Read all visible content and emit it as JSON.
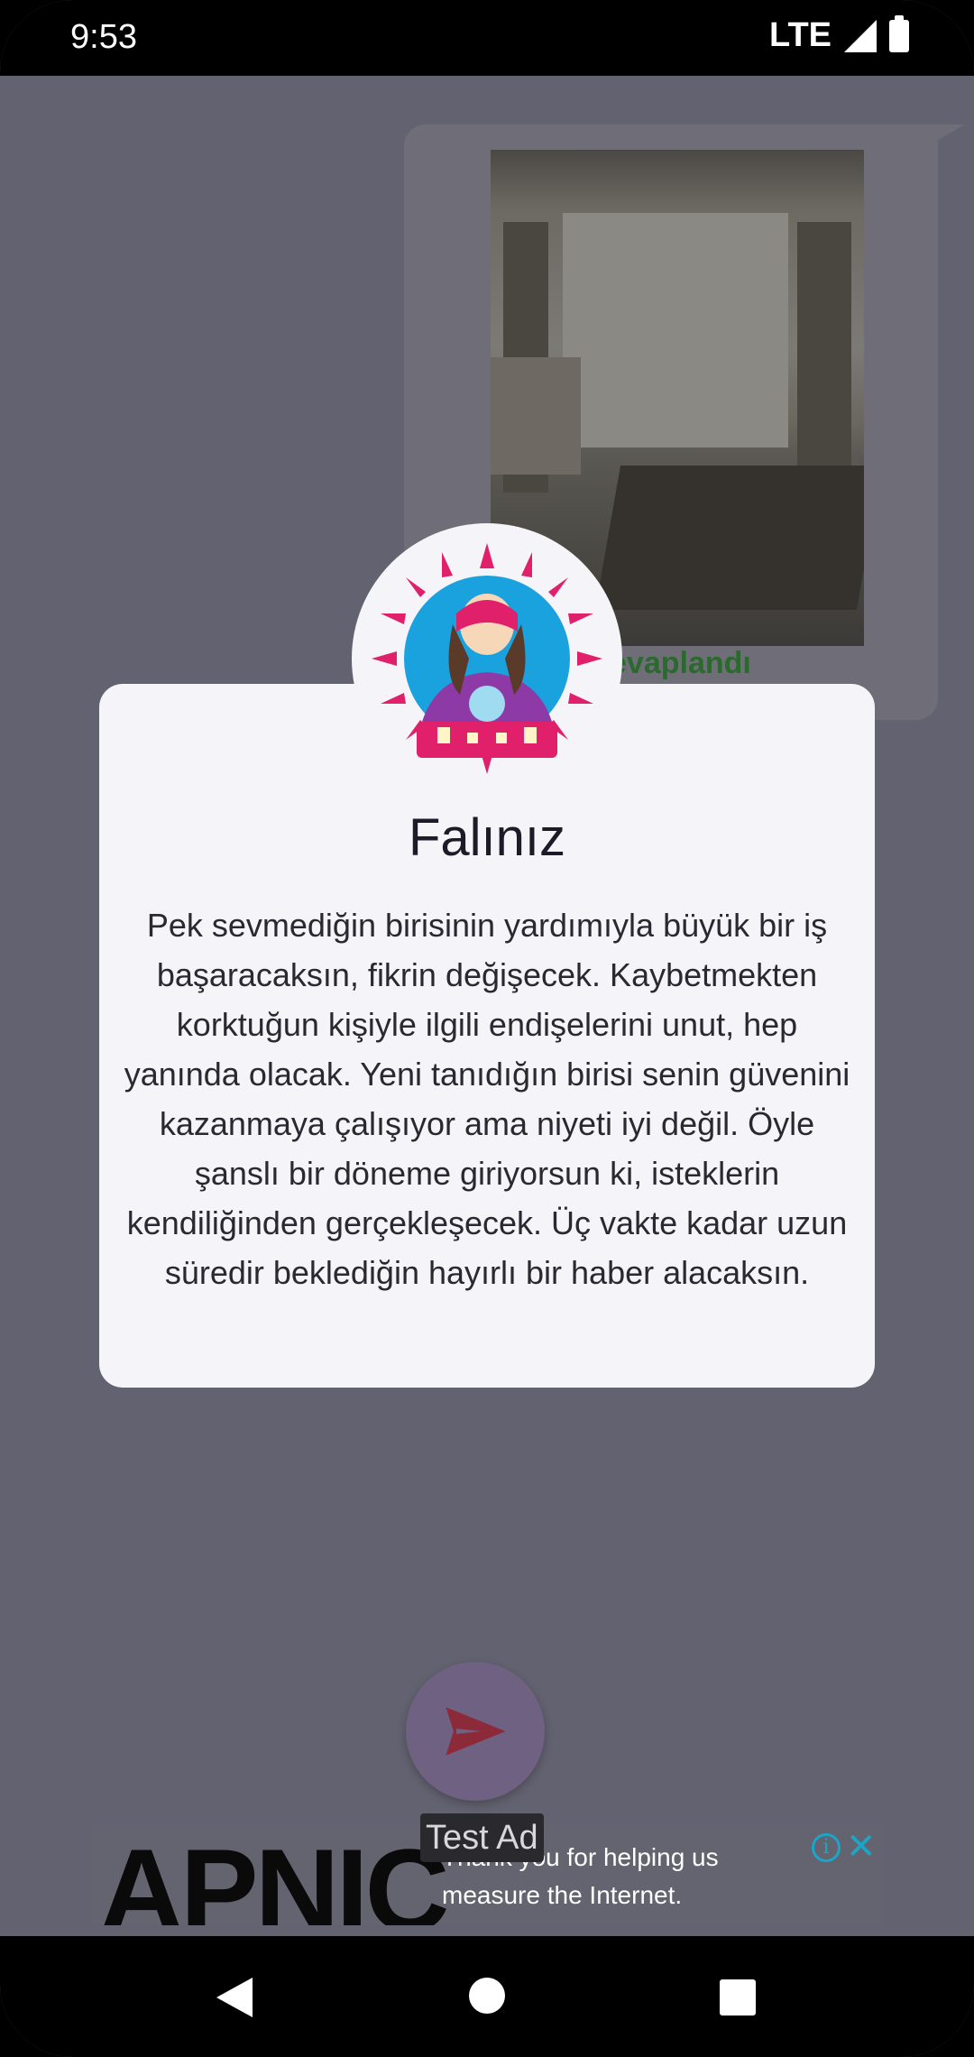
{
  "status_bar": {
    "time": "9:53",
    "network": "LTE"
  },
  "chat": {
    "status_text": "evaplandı"
  },
  "dialog": {
    "title": "Falınız",
    "body": "Pek sevmediğin birisinin yardımıyla büyük bir iş başaracaksın, fikrin değişecek. Kaybetmekten korktuğun kişiyle ilgili endişelerini unut, hep yanında olacak. Yeni tanıdığın birisi senin güvenini kazanmaya çalışıyor ama niyeti iyi değil. Öyle şanslı bir döneme giriyorsun ki, isteklerin kendiliğinden gerçekleşecek. Üç vakte kadar uzun süredir beklediğin hayırlı bir haber alacaksın."
  },
  "ad": {
    "logo_text": "APNIC",
    "message": "Thank you for helping us measure the Internet.",
    "test_label": "Test Ad"
  },
  "colors": {
    "scrim": "#636270",
    "dialog_bg": "#f5f4f9",
    "status_green": "#2a6a2c",
    "fab": "#6f6181",
    "send_icon": "#8d2a3a"
  }
}
